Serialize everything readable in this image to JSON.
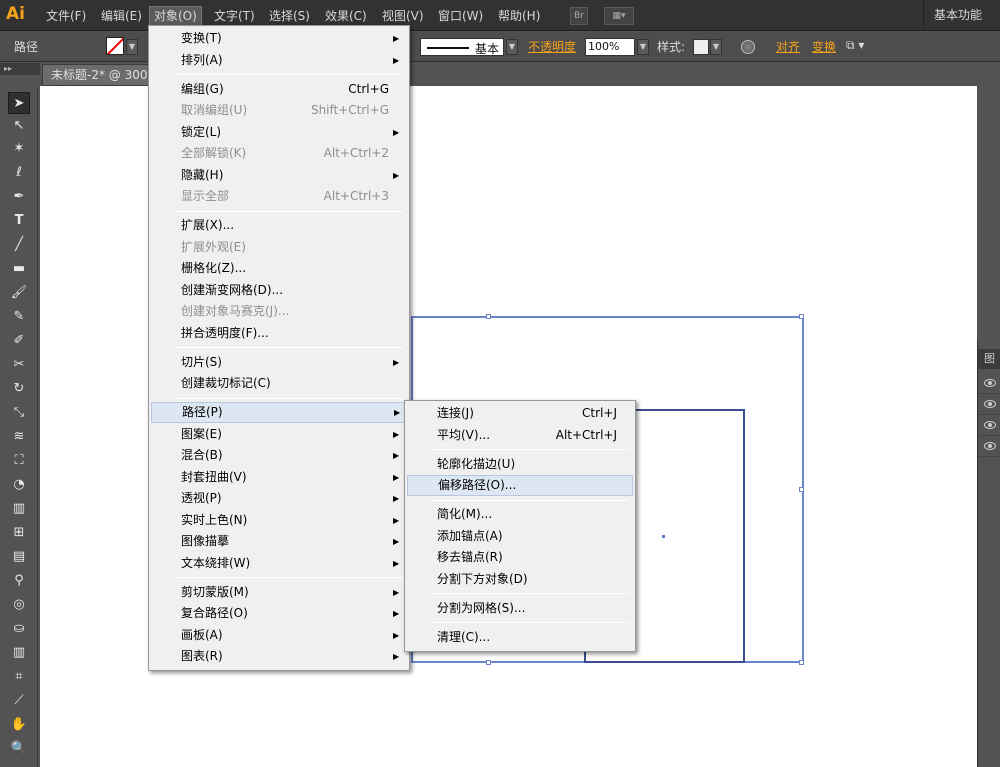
{
  "menubar": {
    "logo": "Ai",
    "items": [
      "文件(F)",
      "编辑(E)",
      "对象(O)",
      "文字(T)",
      "选择(S)",
      "效果(C)",
      "视图(V)",
      "窗口(W)",
      "帮助(H)"
    ],
    "bridge_label": "Br",
    "workspace": "基本功能"
  },
  "controlbar": {
    "selection_label": "路径",
    "stroke_style": "基本",
    "opacity_label": "不透明度",
    "opacity_value": "100%",
    "style_label": "样式:",
    "align_label": "对齐",
    "transform_label": "变换"
  },
  "document_tab": {
    "title": "未标题-2* @ 300%"
  },
  "toolbar": {
    "tools": [
      "selection-tool",
      "direct-selection-tool",
      "magic-wand-tool",
      "lasso-tool",
      "pen-tool",
      "type-tool",
      "line-tool",
      "rectangle-tool",
      "paintbrush-tool",
      "pencil-tool",
      "blob-brush-tool",
      "scissors-tool",
      "rotate-tool",
      "scale-tool",
      "width-tool",
      "free-transform-tool",
      "shape-builder-tool",
      "perspective-grid-tool",
      "mesh-tool",
      "gradient-tool",
      "eyedropper-tool",
      "blend-tool",
      "symbol-sprayer-tool",
      "column-graph-tool",
      "artboard-tool",
      "slice-tool",
      "hand-tool",
      "zoom-tool"
    ]
  },
  "right_panel": {
    "title": "图"
  },
  "object_menu": {
    "groups": [
      [
        {
          "label": "变换(T)",
          "submenu": true
        },
        {
          "label": "排列(A)",
          "submenu": true
        }
      ],
      [
        {
          "label": "编组(G)",
          "shortcut": "Ctrl+G"
        },
        {
          "label": "取消编组(U)",
          "shortcut": "Shift+Ctrl+G",
          "disabled": true
        },
        {
          "label": "锁定(L)",
          "submenu": true
        },
        {
          "label": "全部解锁(K)",
          "shortcut": "Alt+Ctrl+2",
          "disabled": true
        },
        {
          "label": "隐藏(H)",
          "submenu": true
        },
        {
          "label": "显示全部",
          "shortcut": "Alt+Ctrl+3",
          "disabled": true
        }
      ],
      [
        {
          "label": "扩展(X)..."
        },
        {
          "label": "扩展外观(E)",
          "disabled": true
        },
        {
          "label": "栅格化(Z)..."
        },
        {
          "label": "创建渐变网格(D)..."
        },
        {
          "label": "创建对象马赛克(J)...",
          "disabled": true
        },
        {
          "label": "拼合透明度(F)..."
        }
      ],
      [
        {
          "label": "切片(S)",
          "submenu": true
        },
        {
          "label": "创建裁切标记(C)"
        }
      ],
      [
        {
          "label": "路径(P)",
          "submenu": true,
          "hover": true
        },
        {
          "label": "图案(E)",
          "submenu": true
        },
        {
          "label": "混合(B)",
          "submenu": true
        },
        {
          "label": "封套扭曲(V)",
          "submenu": true
        },
        {
          "label": "透视(P)",
          "submenu": true
        },
        {
          "label": "实时上色(N)",
          "submenu": true
        },
        {
          "label": "图像描摹",
          "submenu": true
        },
        {
          "label": "文本绕排(W)",
          "submenu": true
        }
      ],
      [
        {
          "label": "剪切蒙版(M)",
          "submenu": true
        },
        {
          "label": "复合路径(O)",
          "submenu": true
        },
        {
          "label": "画板(A)",
          "submenu": true
        },
        {
          "label": "图表(R)",
          "submenu": true
        }
      ]
    ]
  },
  "path_submenu": {
    "groups": [
      [
        {
          "label": "连接(J)",
          "shortcut": "Ctrl+J"
        },
        {
          "label": "平均(V)...",
          "shortcut": "Alt+Ctrl+J"
        }
      ],
      [
        {
          "label": "轮廓化描边(U)"
        },
        {
          "label": "偏移路径(O)...",
          "hover": true
        }
      ],
      [
        {
          "label": "简化(M)..."
        },
        {
          "label": "添加锚点(A)"
        },
        {
          "label": "移去锚点(R)"
        },
        {
          "label": "分割下方对象(D)"
        }
      ],
      [
        {
          "label": "分割为网格(S)..."
        }
      ],
      [
        {
          "label": "清理(C)..."
        }
      ]
    ]
  },
  "colors": {
    "accent": "#f7a21b",
    "selection_blue": "#6a86c8",
    "menu_hover": "#dde6f3"
  }
}
